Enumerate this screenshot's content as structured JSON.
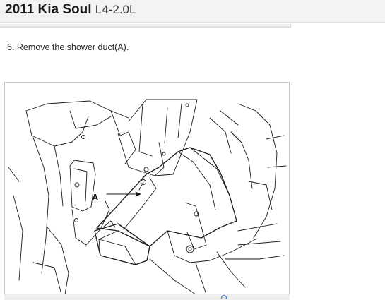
{
  "header": {
    "model": "2011 Kia Soul",
    "engine": "L4-2.0L"
  },
  "procedure": {
    "step_text": "6. Remove the shower duct(A)."
  },
  "figure": {
    "callout_label": "A"
  },
  "colors": {
    "header_background": "#f3f3f3",
    "line_art": "#1a1a1a"
  },
  "icons": [
    "zoom-icon"
  ]
}
